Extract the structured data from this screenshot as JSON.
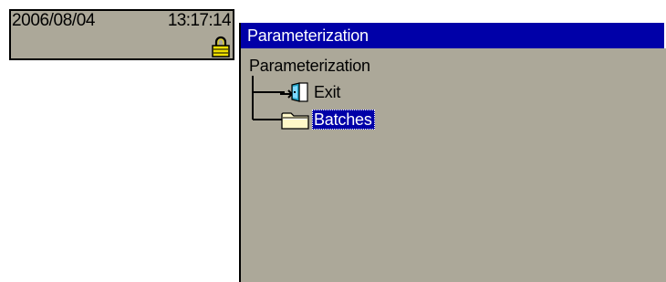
{
  "status": {
    "date": "2006/08/04",
    "time": "13:17:14",
    "lock_icon": "padlock-icon"
  },
  "window": {
    "title": "Parameterization",
    "tree": {
      "root_label": "Parameterization",
      "items": [
        {
          "label": "Exit",
          "icon": "exit-door-icon",
          "selected": false
        },
        {
          "label": "Batches",
          "icon": "folder-icon",
          "selected": true
        }
      ]
    }
  },
  "colors": {
    "panel_background": "#aca899",
    "title_bar": "#0000a8",
    "selection": "#0000a8",
    "text": "#000000",
    "lock_fill": "#f0e000",
    "folder_fill": "#fff8c8"
  }
}
